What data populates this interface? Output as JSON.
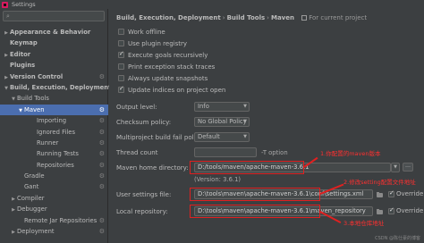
{
  "window": {
    "title": "Settings"
  },
  "sidebar": {
    "search_placeholder": "",
    "items": [
      {
        "label": "Appearance & Behavior",
        "arrow": "▶",
        "bold": true
      },
      {
        "label": "Keymap",
        "arrow": "",
        "bold": true
      },
      {
        "label": "Editor",
        "arrow": "▶",
        "bold": true
      },
      {
        "label": "Plugins",
        "arrow": "",
        "bold": true
      },
      {
        "label": "Version Control",
        "arrow": "▶",
        "bold": true
      },
      {
        "label": "Build, Execution, Deployment",
        "arrow": "▼",
        "bold": true
      },
      {
        "label": "Build Tools",
        "arrow": "▼",
        "bold": false
      },
      {
        "label": "Maven",
        "arrow": "▼",
        "bold": false
      },
      {
        "label": "Importing",
        "arrow": "",
        "bold": false
      },
      {
        "label": "Ignored Files",
        "arrow": "",
        "bold": false
      },
      {
        "label": "Runner",
        "arrow": "",
        "bold": false
      },
      {
        "label": "Running Tests",
        "arrow": "",
        "bold": false
      },
      {
        "label": "Repositories",
        "arrow": "",
        "bold": false
      },
      {
        "label": "Gradle",
        "arrow": "",
        "bold": false
      },
      {
        "label": "Gant",
        "arrow": "",
        "bold": false
      },
      {
        "label": "Compiler",
        "arrow": "▶",
        "bold": false
      },
      {
        "label": "Debugger",
        "arrow": "▶",
        "bold": false
      },
      {
        "label": "Remote Jar Repositories",
        "arrow": "",
        "bold": false
      },
      {
        "label": "Deployment",
        "arrow": "▶",
        "bold": false
      }
    ]
  },
  "breadcrumb": {
    "items": [
      "Build, Execution, Deployment",
      "Build Tools",
      "Maven"
    ],
    "separator": "›",
    "project_scope": "For current project"
  },
  "options": [
    {
      "label": "Work offline",
      "checked": false
    },
    {
      "label": "Use plugin registry",
      "checked": false
    },
    {
      "label": "Execute goals recursively",
      "checked": true
    },
    {
      "label": "Print exception stack traces",
      "checked": false
    },
    {
      "label": "Always update snapshots",
      "checked": false
    },
    {
      "label": "Update indices on project open",
      "checked": true
    }
  ],
  "settings": {
    "output_level": {
      "label": "Output level:",
      "value": "Info"
    },
    "checksum_policy": {
      "label": "Checksum policy:",
      "value": "No Global Policy"
    },
    "multiproject_policy": {
      "label": "Multiproject build fail policy:",
      "value": "Default"
    },
    "thread_count": {
      "label": "Thread count",
      "value": "",
      "hint": "-T option"
    },
    "maven_home": {
      "label": "Maven home directory:",
      "value": "D:/tools/maven/apache-maven-3.6.1",
      "version": "(Version: 3.6.1)"
    },
    "user_settings": {
      "label": "User settings file:",
      "value": "D:\\tools\\maven\\apache-maven-3.6.1\\conf\\settings.xml",
      "override_label": "Override"
    },
    "local_repo": {
      "label": "Local repository:",
      "value": "D:\\tools\\maven\\apache-maven-3.6.1\\maven_repository",
      "override_label": "Override"
    }
  },
  "annotations": {
    "a1": "1.你配置的maven版本",
    "a2": "2.修改setting配置文件地址",
    "a3": "3.本地仓库地址"
  },
  "watermark": "CSDN @陈仕豪的博客",
  "colors": {
    "selection": "#4b6eaf",
    "annotation": "#e02020",
    "background": "#3c3f41"
  }
}
